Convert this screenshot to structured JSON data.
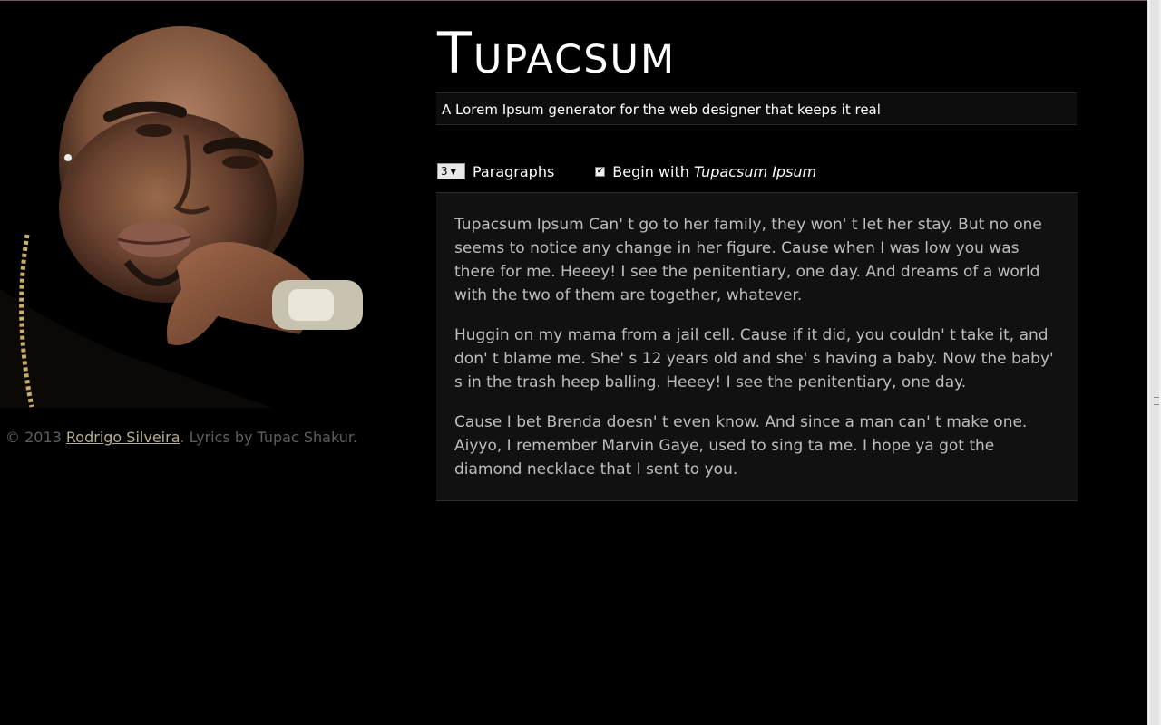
{
  "header": {
    "title": "Tupacsum",
    "tagline": "A Lorem Ipsum generator for the web designer that keeps it real"
  },
  "controls": {
    "paragraphs_value": "3",
    "paragraphs_label": "Paragraphs",
    "begin_with_checked": true,
    "begin_with_label": "Begin with",
    "begin_with_phrase": "Tupacsum Ipsum"
  },
  "lorem": {
    "paragraphs": [
      "Tupacsum Ipsum Can' t go to her family, they won' t let her stay. But no one seems to notice any change in her figure. Cause when I was low you was there for me. Heeey! I see the penitentiary, one day. And dreams of a world with the two of them are together, whatever.",
      "Huggin on my mama from a jail cell. Cause if it did, you couldn' t take it, and don' t blame me. She' s 12 years old and she' s having a baby. Now the baby' s in the trash heep balling. Heeey! I see the penitentiary, one day.",
      "Cause I bet Brenda doesn' t even know. And since a man can' t make one. Aiyyo, I remember Marvin Gaye, used to sing ta me. I hope ya got the diamond necklace that I sent to you."
    ]
  },
  "footer": {
    "copyright": "© 2013",
    "author_link": "Rodrigo Silveira",
    "suffix": ". Lyrics by Tupac Shakur."
  },
  "colors": {
    "background": "#000000",
    "panel": "#111111",
    "text": "#bdbdbd",
    "link": "#b6b08a"
  }
}
